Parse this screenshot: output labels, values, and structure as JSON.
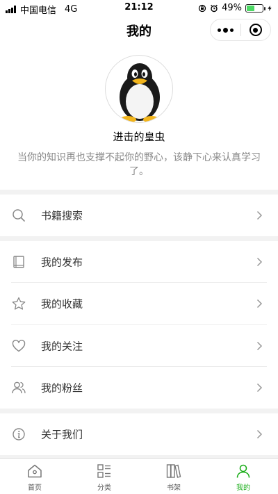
{
  "status_bar": {
    "carrier": "中国电信",
    "network": "4G",
    "time": "21:12",
    "battery_percent": "49%",
    "battery_level": 0.49
  },
  "nav": {
    "title": "我的"
  },
  "profile": {
    "name": "进击的皇虫",
    "motto": "当你的知识再也支撑不起你的野心，该静下心来认真学习了。"
  },
  "menu": {
    "search": {
      "label": "书籍搜索",
      "icon": "search-icon"
    },
    "publish": {
      "label": "我的发布",
      "icon": "book-icon"
    },
    "favorites": {
      "label": "我的收藏",
      "icon": "star-icon"
    },
    "following": {
      "label": "我的关注",
      "icon": "heart-icon"
    },
    "fans": {
      "label": "我的粉丝",
      "icon": "users-icon"
    },
    "about": {
      "label": "关于我们",
      "icon": "info-icon"
    }
  },
  "tabbar": {
    "items": [
      {
        "label": "首页",
        "icon": "home-icon"
      },
      {
        "label": "分类",
        "icon": "category-icon"
      },
      {
        "label": "书架",
        "icon": "bookshelf-icon"
      },
      {
        "label": "我的",
        "icon": "person-icon",
        "active": true
      }
    ]
  },
  "colors": {
    "accent": "#1aad19",
    "battery": "#4cd964",
    "section_gap": "#f2f2f2"
  }
}
